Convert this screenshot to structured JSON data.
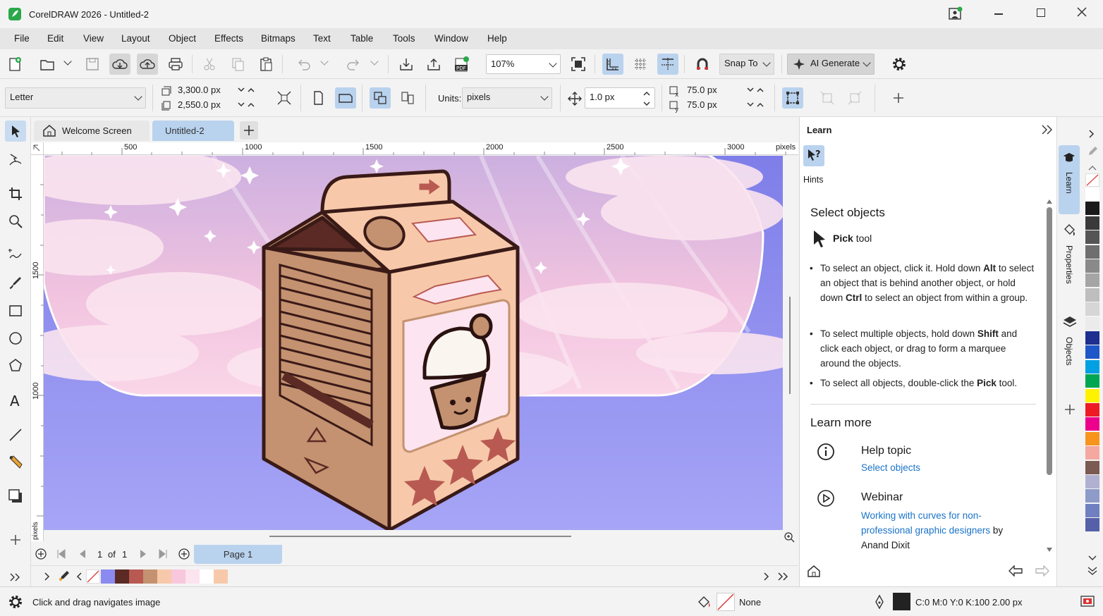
{
  "window": {
    "title": "CorelDRAW 2026 - Untitled-2"
  },
  "menu": [
    "File",
    "Edit",
    "View",
    "Layout",
    "Object",
    "Effects",
    "Bitmaps",
    "Text",
    "Table",
    "Tools",
    "Window",
    "Help"
  ],
  "toolbar": {
    "zoom": "107%",
    "snap_label": "Snap To",
    "ai_label": "AI Generate"
  },
  "property_bar": {
    "page_size": "Letter",
    "width": "3,300.0 px",
    "height": "2,550.0 px",
    "units_label": "Units:",
    "units_value": "pixels",
    "nudge": "1.0 px",
    "dup_x": "75.0 px",
    "dup_y": "75.0 px"
  },
  "tabs": [
    {
      "label": "Welcome Screen"
    },
    {
      "label": "Untitled-2"
    }
  ],
  "ruler": {
    "top_ticks": [
      "500",
      "1000",
      "1500",
      "2000",
      "2500",
      "3000"
    ],
    "unit": "pixels",
    "left_ticks": [
      "1500",
      "1000"
    ],
    "left_unit": "pixels"
  },
  "page_nav": {
    "current": "1",
    "of": "of",
    "total": "1",
    "page_tab": "Page 1"
  },
  "learn": {
    "title": "Learn",
    "hints_label": "Hints",
    "heading": "Select objects",
    "tool_bold": "Pick",
    "tool_rest": " tool",
    "bullets": [
      [
        "To select an object, click it. Hold down ",
        "Alt",
        " to select an object that is behind another object, or hold down ",
        "Ctrl",
        " to select an object from within a group."
      ],
      [
        "To select multiple objects, hold down ",
        "Shift",
        " and click each object, or drag to form a marquee around the objects."
      ],
      [
        "To select all objects, double-click the ",
        "Pick",
        " tool."
      ]
    ],
    "learn_more": "Learn more",
    "help_topic_title": "Help topic",
    "help_topic_link": "Select objects",
    "webinar_title": "Webinar",
    "webinar_link": "Working with curves for non-professional graphic designers",
    "webinar_by": " by",
    "webinar_author": "Anand Dixit"
  },
  "docker_tabs": [
    "Learn",
    "Properties",
    "Objects"
  ],
  "status": {
    "hint": "Click and drag navigates image",
    "fill": "None",
    "outline": "C:0 M:0 Y:0 K:100  2.00 px"
  },
  "doc_palette": [
    "#8b8af0",
    "#5b2a24",
    "#b85a52",
    "#c49270",
    "#f7c9aa",
    "#f8c7dc",
    "#fbe4ee",
    "#ffffff",
    "#f7c9aa"
  ],
  "palette": [
    "#ffffff",
    "#1a1a1a",
    "#3a3a3a",
    "#555555",
    "#6f6f6f",
    "#8a8a8a",
    "#a5a5a5",
    "#bebebe",
    "#d6d6d6",
    "#ebebeb",
    "#1e2f8f",
    "#1f57c8",
    "#00a0e3",
    "#00a651",
    "#fff200",
    "#ed1c24",
    "#ec008c",
    "#f7941d",
    "#f4a8a0",
    "#7a5a52",
    "#b0b0d0",
    "#8e9ac8",
    "#6f7fc0",
    "#5560a8"
  ]
}
